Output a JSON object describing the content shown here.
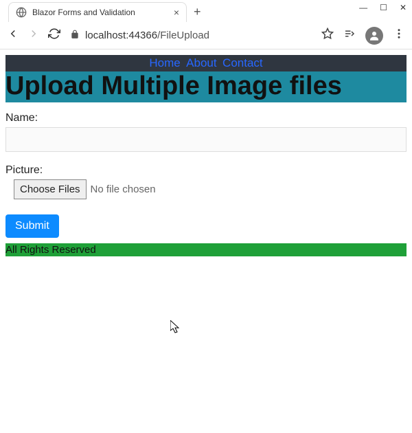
{
  "browser": {
    "tab_title": "Blazor Forms and Validation",
    "url_host": "localhost",
    "url_port": ":44366",
    "url_path": "/FileUpload"
  },
  "nav": {
    "home": "Home",
    "about": "About",
    "contact": "Contact"
  },
  "page": {
    "heading": "Upload Multiple Image files",
    "name_label": "Name:",
    "name_value": "",
    "picture_label": "Picture:",
    "choose_files_label": "Choose Files",
    "file_status": "No file chosen",
    "submit_label": "Submit",
    "footer": "All Rights Reserved"
  }
}
